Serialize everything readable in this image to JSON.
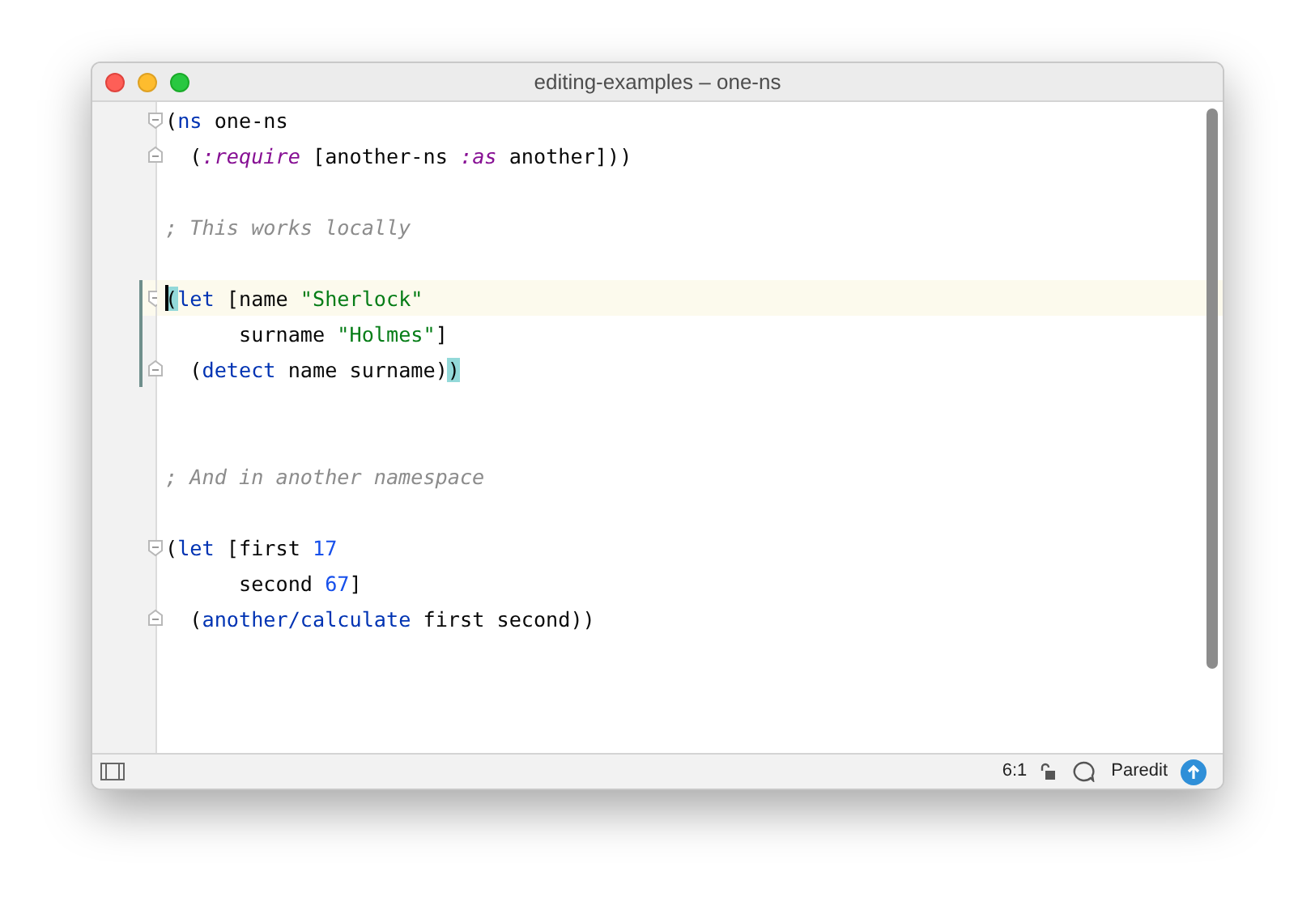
{
  "window": {
    "title": "editing-examples – one-ns"
  },
  "lines": [
    {
      "kind": "code",
      "fold_start": true,
      "fold_end": false,
      "current": false,
      "changed": false,
      "caret": false,
      "tokens": [
        {
          "kind": "plain",
          "text": "("
        },
        {
          "kind": "keyword",
          "text": "ns"
        },
        {
          "kind": "plain",
          "text": " one-ns"
        }
      ]
    },
    {
      "kind": "code",
      "fold_start": false,
      "fold_end": true,
      "current": false,
      "changed": false,
      "caret": false,
      "tokens": [
        {
          "kind": "plain",
          "text": "  ("
        },
        {
          "kind": "literal",
          "text": ":require"
        },
        {
          "kind": "plain",
          "text": " [another-ns "
        },
        {
          "kind": "literal",
          "text": ":as"
        },
        {
          "kind": "plain",
          "text": " another]))"
        }
      ]
    },
    {
      "kind": "blank"
    },
    {
      "kind": "code",
      "fold_start": false,
      "fold_end": false,
      "current": false,
      "changed": false,
      "caret": false,
      "tokens": [
        {
          "kind": "comment",
          "text": "; This works locally"
        }
      ]
    },
    {
      "kind": "blank"
    },
    {
      "kind": "code",
      "fold_start": true,
      "fold_end": false,
      "current": true,
      "changed": true,
      "caret": true,
      "tokens": [
        {
          "kind": "paren-match",
          "text": "("
        },
        {
          "kind": "keyword",
          "text": "let"
        },
        {
          "kind": "plain",
          "text": " [name "
        },
        {
          "kind": "string",
          "text": "\"Sherlock\""
        }
      ]
    },
    {
      "kind": "code",
      "fold_start": false,
      "fold_end": false,
      "current": false,
      "changed": true,
      "caret": false,
      "tokens": [
        {
          "kind": "plain",
          "text": "      surname "
        },
        {
          "kind": "string",
          "text": "\"Holmes\""
        },
        {
          "kind": "plain",
          "text": "]"
        }
      ]
    },
    {
      "kind": "code",
      "fold_start": false,
      "fold_end": true,
      "current": false,
      "changed": true,
      "caret": false,
      "tokens": [
        {
          "kind": "plain",
          "text": "  ("
        },
        {
          "kind": "keyword",
          "text": "detect"
        },
        {
          "kind": "plain",
          "text": " name surname)"
        },
        {
          "kind": "paren-match",
          "text": ")"
        }
      ]
    },
    {
      "kind": "blank"
    },
    {
      "kind": "blank"
    },
    {
      "kind": "code",
      "fold_start": false,
      "fold_end": false,
      "current": false,
      "changed": false,
      "caret": false,
      "tokens": [
        {
          "kind": "comment",
          "text": "; And in another namespace"
        }
      ]
    },
    {
      "kind": "blank"
    },
    {
      "kind": "code",
      "fold_start": true,
      "fold_end": false,
      "current": false,
      "changed": false,
      "caret": false,
      "tokens": [
        {
          "kind": "plain",
          "text": "("
        },
        {
          "kind": "keyword",
          "text": "let"
        },
        {
          "kind": "plain",
          "text": " [first "
        },
        {
          "kind": "number",
          "text": "17"
        }
      ]
    },
    {
      "kind": "code",
      "fold_start": false,
      "fold_end": false,
      "current": false,
      "changed": false,
      "caret": false,
      "tokens": [
        {
          "kind": "plain",
          "text": "      second "
        },
        {
          "kind": "number",
          "text": "67"
        },
        {
          "kind": "plain",
          "text": "]"
        }
      ]
    },
    {
      "kind": "code",
      "fold_start": false,
      "fold_end": true,
      "current": false,
      "changed": false,
      "caret": false,
      "tokens": [
        {
          "kind": "plain",
          "text": "  ("
        },
        {
          "kind": "keyword",
          "text": "another/calculate"
        },
        {
          "kind": "plain",
          "text": " first second))"
        }
      ]
    }
  ],
  "status_bar": {
    "position": "6:1",
    "mode": "Paredit"
  }
}
